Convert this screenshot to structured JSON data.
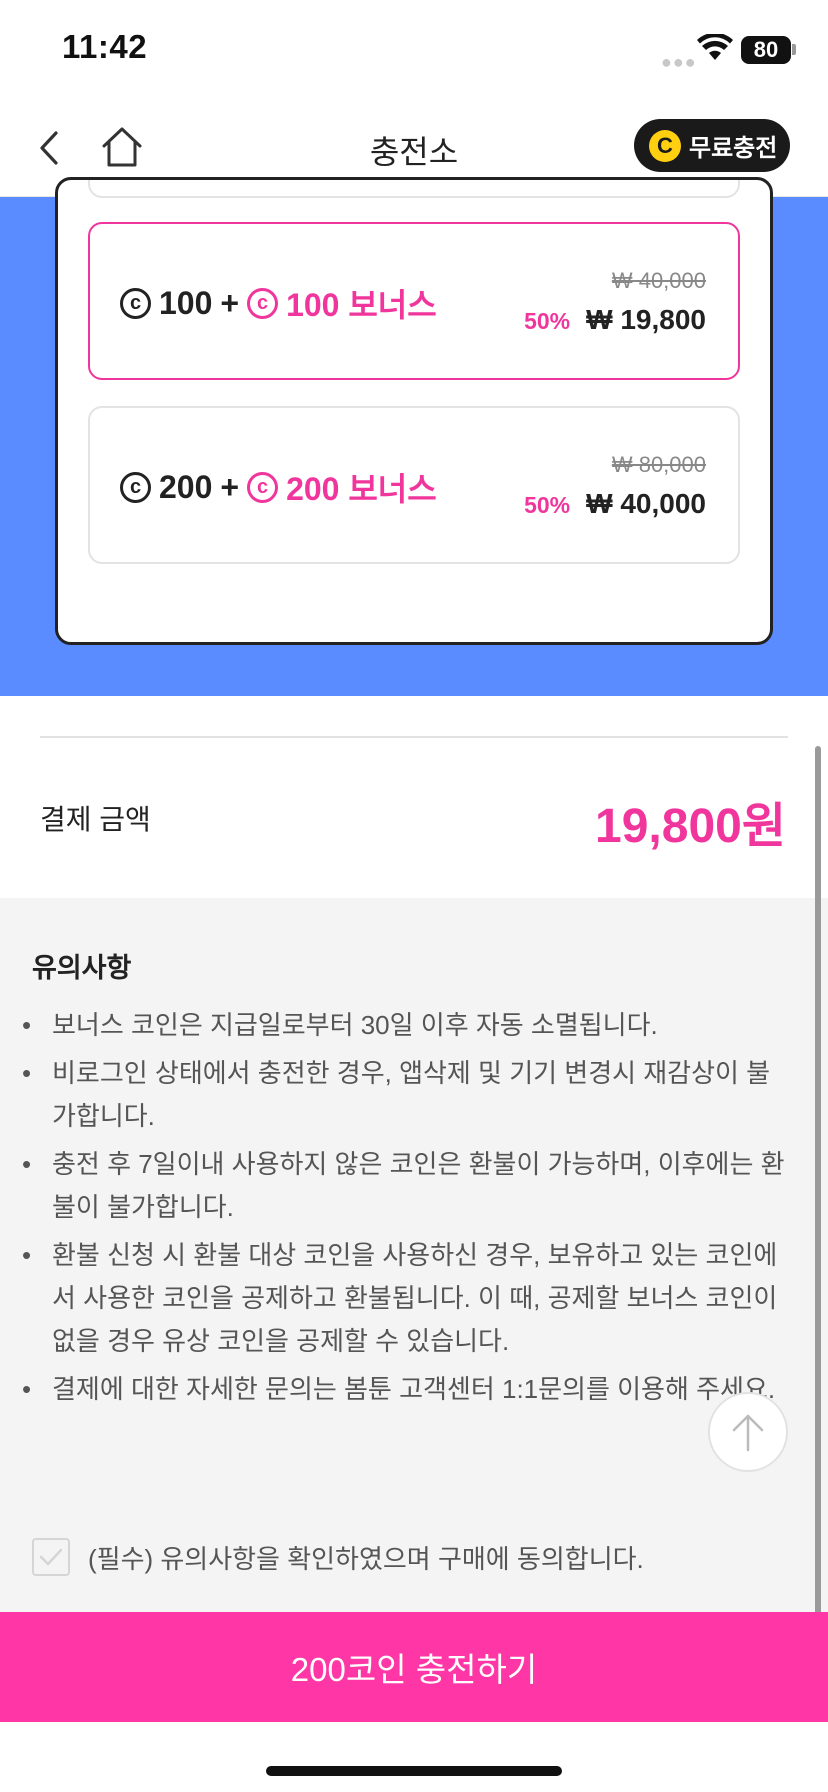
{
  "status_bar": {
    "time": "11:42",
    "battery": "80"
  },
  "header": {
    "title": "충전소",
    "free_charge_label": "무료충전",
    "coin_glyph": "C"
  },
  "options": [
    {
      "base": "100",
      "plus": "+",
      "bonus": "100 보너스",
      "original_price": "₩ 40,000",
      "discount": "50%",
      "price": "₩ 19,800",
      "selected": true
    },
    {
      "base": "200",
      "plus": "+",
      "bonus": "200 보너스",
      "original_price": "₩ 80,000",
      "discount": "50%",
      "price": "₩ 40,000",
      "selected": false
    }
  ],
  "coin_mark": "c",
  "payment": {
    "label": "결제 금액",
    "amount": "19,800원"
  },
  "notes": {
    "title": "유의사항",
    "items": [
      "보너스 코인은 지급일로부터 30일 이후 자동 소멸됩니다.",
      "비로그인 상태에서 충전한 경우, 앱삭제 및 기기 변경시 재감상이 불가합니다.",
      "충전 후 7일이내 사용하지 않은 코인은 환불이 가능하며, 이후에는 환불이 불가합니다.",
      "환불 신청 시 환불 대상 코인을 사용하신 경우, 보유하고 있는 코인에서 사용한 코인을 공제하고 환불됩니다. 이 때, 공제할 보너스 코인이 없을 경우 유상 코인을 공제할 수 있습니다.",
      "결제에 대한 자세한 문의는 봄툰 고객센터 1:1문의를 이용해 주세요."
    ]
  },
  "agreement": {
    "text": "(필수) 유의사항을 확인하였으며 구매에 동의합니다.",
    "checked": false
  },
  "cta": {
    "label": "200코인 충전하기"
  },
  "colors": {
    "accent": "#f0369d",
    "cta": "#ff36a6",
    "panel": "#5b8cff",
    "coin": "#ffcf10"
  },
  "icons": [
    "back-icon",
    "home-icon",
    "coin-icon",
    "check-icon",
    "arrow-up-icon",
    "wifi-icon"
  ]
}
